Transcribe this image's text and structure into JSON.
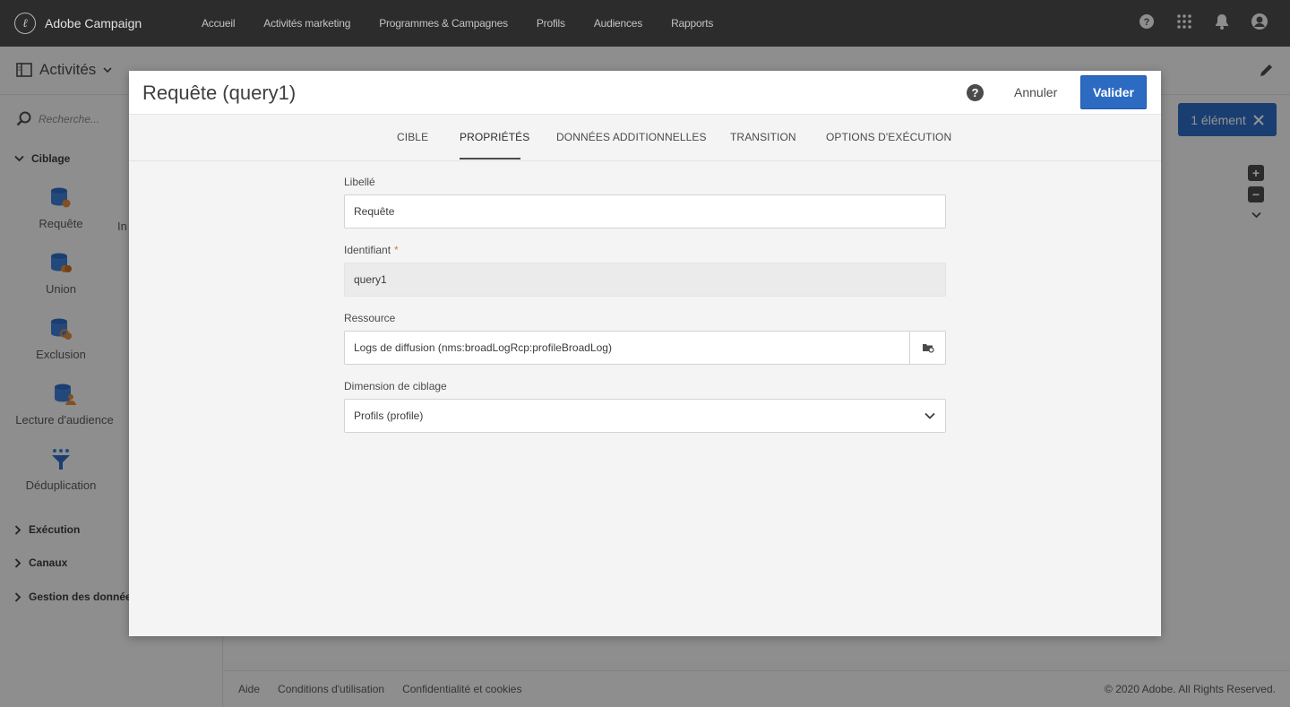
{
  "topbar": {
    "brand": "Adobe Campaign",
    "nav": [
      "Accueil",
      "Activités marketing",
      "Programmes & Campagnes",
      "Profils",
      "Audiences",
      "Rapports"
    ],
    "icons": [
      "help-icon",
      "apps-grid-icon",
      "bell-icon",
      "user-avatar-icon"
    ]
  },
  "appbar": {
    "title": "Activités"
  },
  "leftpanel": {
    "search_placeholder": "Recherche...",
    "section_ciblage": "Ciblage",
    "activities": [
      {
        "label": "Requête",
        "icon": "query-icon"
      },
      {
        "label": "Union",
        "icon": "union-icon"
      },
      {
        "label": "Exclusion",
        "icon": "exclusion-icon"
      },
      {
        "label": "Lecture d'audience",
        "icon": "read-audience-icon"
      },
      {
        "label": "Déduplication",
        "icon": "deduplication-icon"
      }
    ],
    "partial_label": "In",
    "sections": [
      "Exécution",
      "Canaux",
      "Gestion des donnée"
    ]
  },
  "canvas": {
    "selection_label": "1 élément"
  },
  "footer": {
    "links": [
      "Aide",
      "Conditions d'utilisation",
      "Confidentialité et cookies"
    ],
    "copyright": "© 2020 Adobe. All Rights Reserved."
  },
  "modal": {
    "title": "Requête (query1)",
    "cancel_label": "Annuler",
    "ok_label": "Valider",
    "tabs": [
      "CIBLE",
      "PROPRIÉTÉS",
      "DONNÉES ADDITIONNELLES",
      "TRANSITION",
      "OPTIONS D'EXÉCUTION"
    ],
    "active_tab": "PROPRIÉTÉS",
    "fields": {
      "label_caption": "Libellé",
      "label_value": "Requête",
      "id_caption": "Identifiant",
      "id_required": "*",
      "id_value": "query1",
      "resource_caption": "Ressource",
      "resource_value": "Logs de diffusion (nms:broadLogRcp:profileBroadLog)",
      "dimension_caption": "Dimension de ciblage",
      "dimension_value": "Profils (profile)"
    }
  },
  "colors": {
    "accent": "#2d6bc3",
    "topbar": "#2c2c2c",
    "required": "#e07a3c"
  }
}
